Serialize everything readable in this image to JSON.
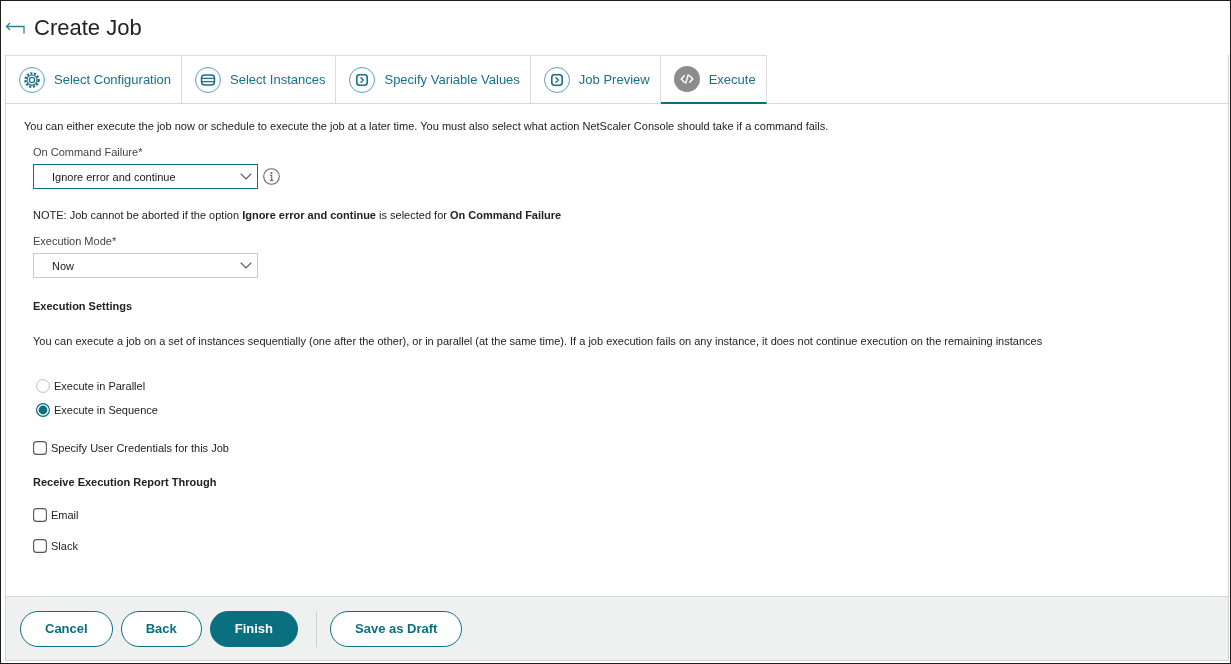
{
  "header": {
    "title": "Create Job"
  },
  "tabs": [
    {
      "label": "Select Configuration",
      "kind": "configuration",
      "selected": false
    },
    {
      "label": "Select Instances",
      "kind": "instances",
      "selected": false
    },
    {
      "label": "Specify Variable Values",
      "kind": "variables",
      "selected": false
    },
    {
      "label": "Job Preview",
      "kind": "preview",
      "selected": false
    },
    {
      "label": "Execute",
      "kind": "execute",
      "selected": true
    }
  ],
  "intro": "You can either execute the job now or schedule to execute the job at a later time. You must also select what action NetScaler Console should take if a command fails.",
  "on_command_failure": {
    "label": "On Command Failure*",
    "value": "Ignore error and continue",
    "focused": true,
    "info_icon": true
  },
  "note": "NOTE: Job cannot be aborted if the option **Ignore error and continue** is selected for **On Command Failure**",
  "execution_mode": {
    "label": "Execution Mode*",
    "value": "Now",
    "focused": false
  },
  "execution_settings": {
    "heading": "Execution Settings",
    "description": "You can execute a job on a set of instances sequentially (one after the other), or in parallel (at the same time). If a job execution fails on any instance, it does not continue execution on the remaining instances",
    "options": [
      {
        "label": "Execute in Parallel",
        "selected": false
      },
      {
        "label": "Execute in Sequence",
        "selected": true
      }
    ]
  },
  "credentials": {
    "label": "Specify User Credentials for this Job",
    "checked": false
  },
  "report": {
    "heading": "Receive Execution Report Through",
    "options": [
      {
        "label": "Email",
        "checked": false
      },
      {
        "label": "Slack",
        "checked": false
      }
    ]
  },
  "footer": {
    "buttons": [
      {
        "label": "Cancel",
        "kind": "secondary"
      },
      {
        "label": "Back",
        "kind": "secondary"
      },
      {
        "label": "Finish",
        "kind": "primary"
      }
    ],
    "draft_buttons": [
      {
        "label": "Save as Draft",
        "kind": "secondary"
      }
    ]
  }
}
